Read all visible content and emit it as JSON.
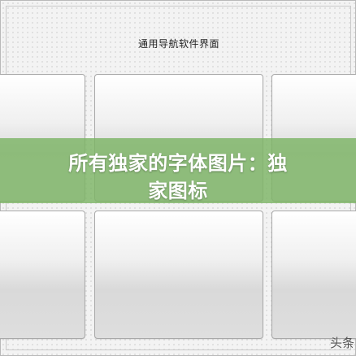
{
  "window": {
    "title": "通用导航软件界面"
  },
  "banner": {
    "line1": "所有独家的字体图片：独",
    "line2": "家图标"
  },
  "watermark": {
    "text": "头条"
  }
}
